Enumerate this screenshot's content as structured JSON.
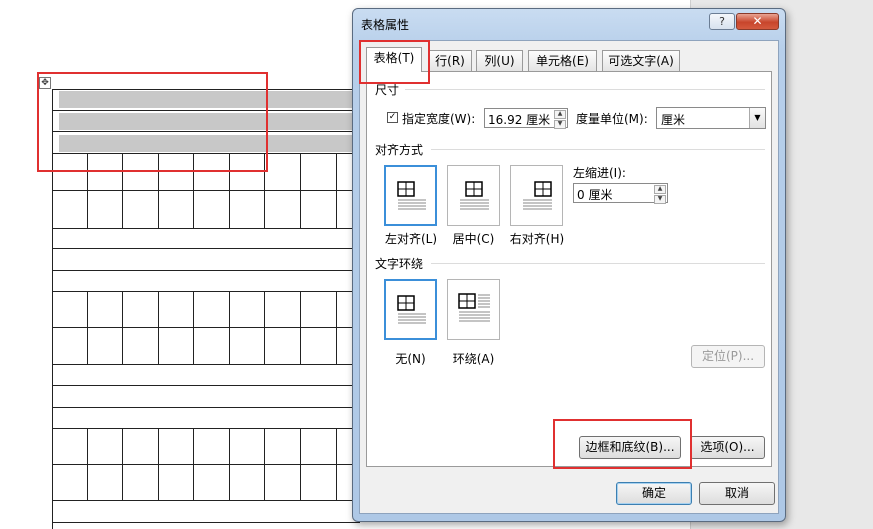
{
  "dialog": {
    "title": "表格属性",
    "help": "?",
    "close": "✕",
    "tabs": [
      "表格(T)",
      "行(R)",
      "列(U)",
      "单元格(E)",
      "可选文字(A)"
    ],
    "size": {
      "group": "尺寸",
      "preferred_width_label": "指定宽度(W):",
      "preferred_width_checked": true,
      "preferred_width_value": "16.92 厘米",
      "measure_in_label": "度量单位(M):",
      "measure_in_value": "厘米"
    },
    "alignment": {
      "group": "对齐方式",
      "options": [
        "左对齐(L)",
        "居中(C)",
        "右对齐(H)"
      ],
      "selected": "左对齐(L)",
      "indent_label": "左缩进(I):",
      "indent_value": "0 厘米"
    },
    "wrapping": {
      "group": "文字环绕",
      "options": [
        "无(N)",
        "环绕(A)"
      ],
      "selected": "无(N)",
      "positioning_button": "定位(P)..."
    },
    "borders_button": "边框和底纹(B)...",
    "options_button": "选项(O)...",
    "ok_button": "确定",
    "cancel_button": "取消"
  },
  "document": {
    "table_move_handle": "✥"
  },
  "colors": {
    "highlight_red": "#e03030",
    "title_bar": "#b7cfea",
    "selected_option_border": "#3b8fd9"
  }
}
